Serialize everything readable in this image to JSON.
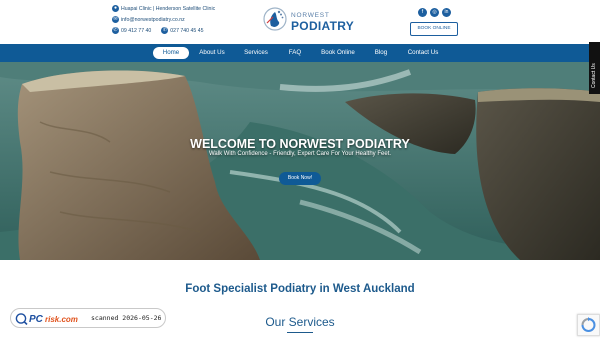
{
  "contact": {
    "clinics": "Huapai Clinic | Henderson Satellite Clinic",
    "email": "info@norwestpodiatry.co.nz",
    "phone1": "09 412 77 40",
    "phone2": "027 740 45 45"
  },
  "logo": {
    "top": "NORWEST",
    "bottom": "PODIATRY"
  },
  "social": {
    "facebook": "f",
    "instagram": "◎",
    "linkedin": "in"
  },
  "header": {
    "book_online": "BOOK ONLINE"
  },
  "nav": {
    "items": [
      {
        "label": "Home"
      },
      {
        "label": "About Us"
      },
      {
        "label": "Services"
      },
      {
        "label": "FAQ"
      },
      {
        "label": "Book Online"
      },
      {
        "label": "Blog"
      },
      {
        "label": "Contact Us"
      }
    ]
  },
  "side_tab": {
    "label": "Contact Us"
  },
  "hero": {
    "title": "WELCOME TO NORWEST PODIATRY",
    "subtitle": "Walk With Confidence - Friendly, Expert Care For Your Healthy Feet.",
    "button": "Book Now!"
  },
  "main": {
    "heading": "Foot Specialist Podiatry in West Auckland",
    "services_heading": "Our Services"
  },
  "scanner_badge": {
    "brand_pc": "PC",
    "brand_risk": "risk.com",
    "text": "scanned 2026-05-26"
  },
  "colors": {
    "primary": "#0f5a96",
    "heading": "#1d5a8c",
    "nav": "#0f5a96"
  }
}
